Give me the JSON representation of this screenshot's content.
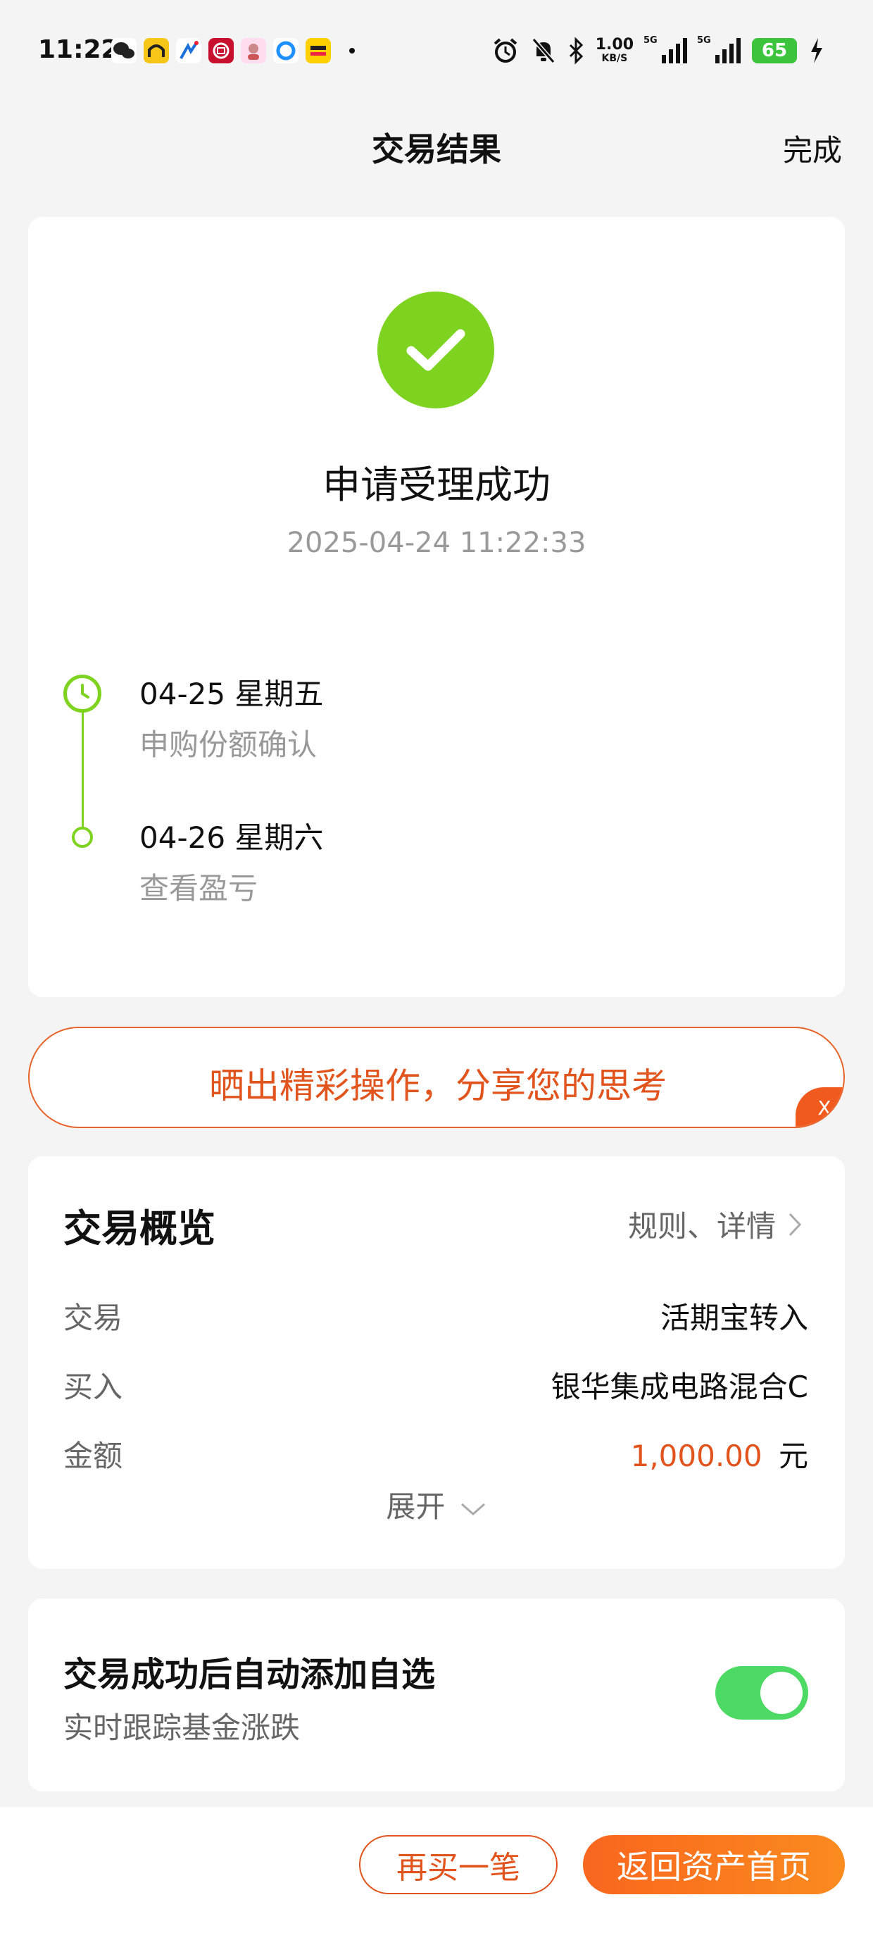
{
  "status_bar": {
    "time": "11:22",
    "net_speed_value": "1.00",
    "net_speed_unit": "KB/S",
    "sim1_label": "5G",
    "sim2_label": "5G",
    "battery": "65"
  },
  "header": {
    "title": "交易结果",
    "done_label": "完成"
  },
  "result": {
    "title": "申请受理成功",
    "timestamp": "2025-04-24 11:22:33",
    "timeline": [
      {
        "date": "04-25  星期五",
        "desc": "申购份额确认"
      },
      {
        "date": "04-26  星期六",
        "desc": "查看盈亏"
      }
    ]
  },
  "share_banner": {
    "text": "晒出精彩操作，分享您的思考",
    "close_label": "X"
  },
  "overview": {
    "title": "交易概览",
    "link_label": "规则、详情",
    "rows": [
      {
        "label": "交易",
        "value": "活期宝转入"
      },
      {
        "label": "买入",
        "value": "银华集成电路混合C"
      },
      {
        "label": "金额",
        "amount": "1,000.00",
        "unit": "元"
      }
    ],
    "expand_label": "展开"
  },
  "auto_add": {
    "title": "交易成功后自动添加自选",
    "subtitle": "实时跟踪基金涨跌",
    "enabled": true
  },
  "bottom": {
    "buy_again_label": "再买一笔",
    "home_label": "返回资产首页"
  },
  "colors": {
    "accent": "#e2541d",
    "success": "#7ed321",
    "toggle_on": "#4cd964"
  }
}
